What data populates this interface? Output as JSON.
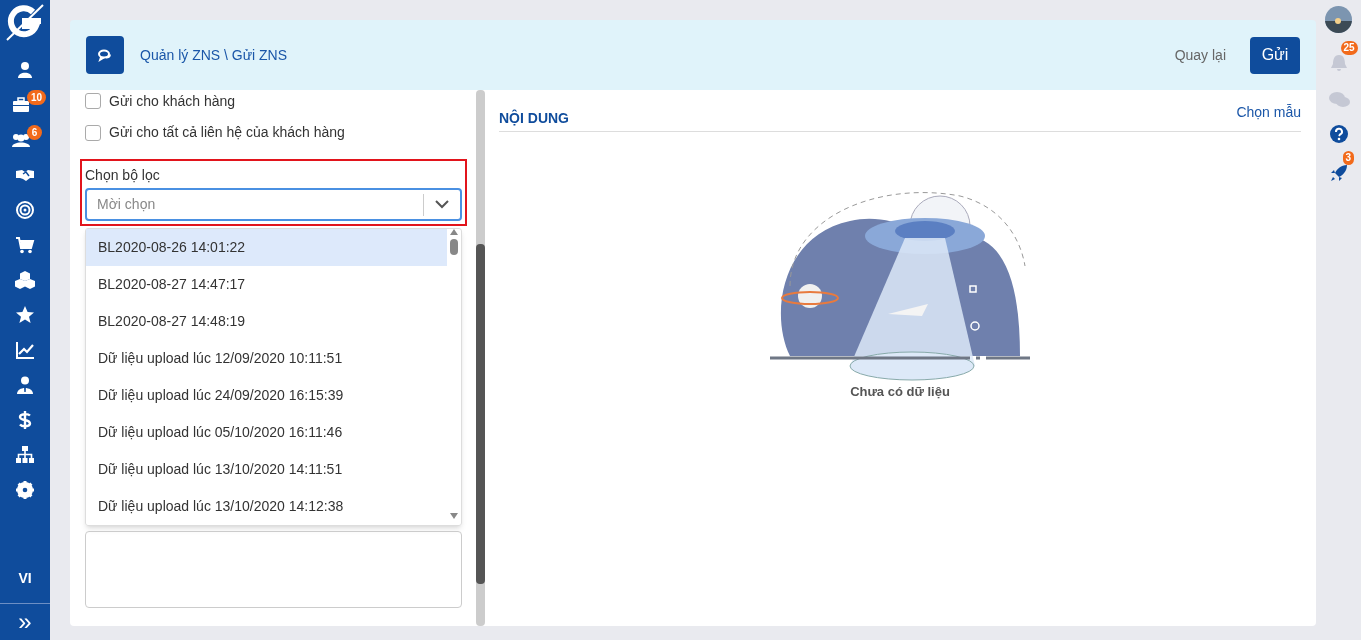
{
  "sidebar": {
    "items": [
      {
        "kind": "user"
      },
      {
        "kind": "briefcase",
        "badge": "10"
      },
      {
        "kind": "users",
        "badge": "6"
      },
      {
        "kind": "handshake"
      },
      {
        "kind": "target"
      },
      {
        "kind": "cart"
      },
      {
        "kind": "cubes"
      },
      {
        "kind": "star"
      },
      {
        "kind": "chart"
      },
      {
        "kind": "manager"
      },
      {
        "kind": "dollar"
      },
      {
        "kind": "org"
      },
      {
        "kind": "gear"
      }
    ],
    "language": "VI",
    "expand": "»"
  },
  "header": {
    "breadcrumb": "Quản lý ZNS \\ Gửi ZNS",
    "back": "Quay lại",
    "send": "Gửi"
  },
  "recipients": [
    {
      "label": "Gửi cho khách hàng",
      "checked": false
    },
    {
      "label": "Gửi cho tất cả liên hệ của khách hàng",
      "checked": false
    }
  ],
  "filter": {
    "label": "Chọn bộ lọc",
    "placeholder": "Mời chọn",
    "options": [
      {
        "label": "BL2020-08-26 14:01:22",
        "selected": true
      },
      {
        "label": "BL2020-08-27 14:47:17",
        "selected": false
      },
      {
        "label": "BL2020-08-27 14:48:19",
        "selected": false
      },
      {
        "label": "Dữ liệu upload lúc 12/09/2020 10:11:51",
        "selected": false
      },
      {
        "label": "Dữ liệu upload lúc 24/09/2020 16:15:39",
        "selected": false
      },
      {
        "label": "Dữ liệu upload lúc 05/10/2020 16:11:46",
        "selected": false
      },
      {
        "label": "Dữ liệu upload lúc 13/10/2020 14:11:51",
        "selected": false
      },
      {
        "label": "Dữ liệu upload lúc 13/10/2020 14:12:38",
        "selected": false
      }
    ]
  },
  "content": {
    "title": "NỘI DUNG",
    "template_link": "Chọn mẫu",
    "empty": "Chưa có dữ liệu"
  },
  "right_rail": {
    "notifications_badge": "25",
    "rocket_badge": "3"
  }
}
